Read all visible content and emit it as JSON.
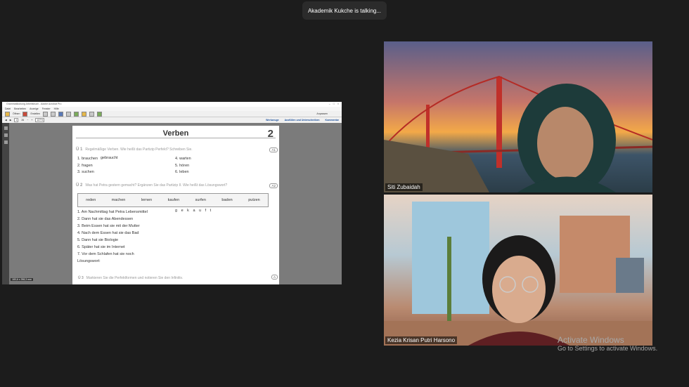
{
  "toast": "Akademik Kukche is talking...",
  "app": {
    "title": "Grammatikubung Arbeitsbuch - Adobe Acrobat Pro",
    "menu": [
      "Datei",
      "Bearbeiten",
      "Anzeige",
      "Fenster",
      "Hilfe"
    ],
    "toolbar1": {
      "open_label": "Öffnen",
      "create_label": "Erstellen",
      "view_label": "Anpassen"
    },
    "toolbar2": {
      "page": "1",
      "pages": "26",
      "zoom": "137%",
      "tools": "Werkzeuge",
      "fill_sign": "Ausfüllen und Unterschreiben",
      "comment": "Kommentar"
    },
    "page_size": "183,6 x 258,3 mm"
  },
  "doc": {
    "title": "Verben",
    "page_number": "2",
    "ex1": {
      "num": "Ü 1",
      "instruction": "Regelmäßige Verben. Wie heißt das Partizip Perfekt? Schreiben Sie.",
      "tag": "A1",
      "words_left": [
        "1. brauchen",
        "2. fragen",
        "3. suchen"
      ],
      "answer": "gebraucht",
      "words_right": [
        "4. warten",
        "5. hören",
        "6. leben"
      ]
    },
    "ex2": {
      "num": "Ü 2",
      "instruction": "Was hat Petra gestern gemacht? Ergänzen Sie das Partizip II. Wie heißt das Lösungswort?",
      "tag": "A2",
      "wordbox": [
        "reden",
        "machen",
        "lernen",
        "kaufen",
        "surfen",
        "baden",
        "putzen"
      ],
      "letters": "g e k a u f t",
      "sentences": [
        "1. Am Nachmittag hat Petra Lebensmittel",
        "2. Dann hat sie das Abendessen",
        "3. Beim Essen hat sie mit der Mutter",
        "4. Nach dem Essen hat sie das Bad",
        "5. Dann hat sie Biologie",
        "6. Später hat sie im Internet",
        "7. Vor dem Schlafen hat sie noch",
        "Lösungswort:"
      ]
    },
    "ex3": {
      "num": "Ü 3",
      "instruction": "Markieren Sie die Perfektformen und notieren Sie den Infinitiv.",
      "tag": "A"
    }
  },
  "participants": [
    {
      "name": "Siti Zubaidah"
    },
    {
      "name": "Kezia Krisan Putri Harsono"
    }
  ],
  "watermark": {
    "line1": "Activate Windows",
    "line2": "Go to Settings to activate Windows."
  }
}
